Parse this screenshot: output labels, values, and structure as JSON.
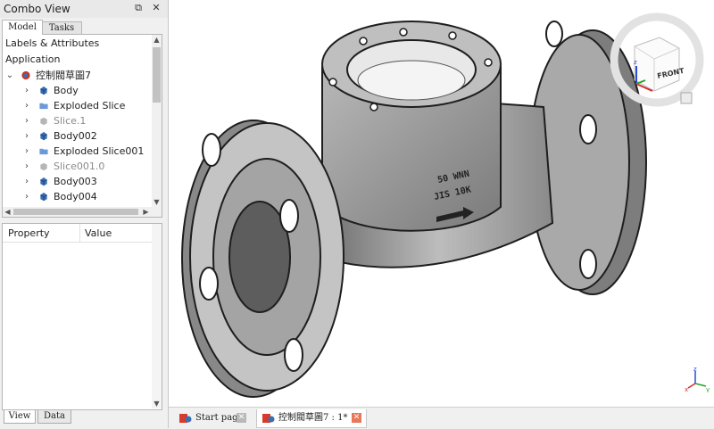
{
  "panel": {
    "title": "Combo View",
    "tabs": [
      "Model",
      "Tasks"
    ],
    "tree": {
      "header1": "Labels & Attributes",
      "header2": "Application",
      "root": "控制閥草圖7",
      "items": [
        {
          "label": "Body",
          "icon": "body-icon",
          "greyed": false
        },
        {
          "label": "Exploded Slice",
          "icon": "folder-icon",
          "greyed": false
        },
        {
          "label": "Slice.1",
          "icon": "slice-cube-icon",
          "greyed": true
        },
        {
          "label": "Body002",
          "icon": "body-icon",
          "greyed": false
        },
        {
          "label": "Exploded Slice001",
          "icon": "folder-icon",
          "greyed": false
        },
        {
          "label": "Slice001.0",
          "icon": "slice-cube-icon",
          "greyed": true
        },
        {
          "label": "Body003",
          "icon": "body-icon",
          "greyed": false
        },
        {
          "label": "Body004",
          "icon": "body-icon",
          "greyed": false
        }
      ]
    },
    "properties": {
      "col1": "Property",
      "col2": "Value"
    },
    "bottom_tabs": [
      "View",
      "Data"
    ]
  },
  "viewport": {
    "navcube_face": "FRONT",
    "axis_labels": {
      "x": "x",
      "y": "y",
      "z": "z"
    },
    "valve_markings": [
      "50 WNN",
      "JIS 10K"
    ]
  },
  "doc_tabs": [
    {
      "label": "Start page",
      "active": false
    },
    {
      "label": "控制閥草圖7 : 1*",
      "active": true
    }
  ],
  "colors": {
    "accent": "#3a6fb4",
    "close": "#e9775a"
  }
}
